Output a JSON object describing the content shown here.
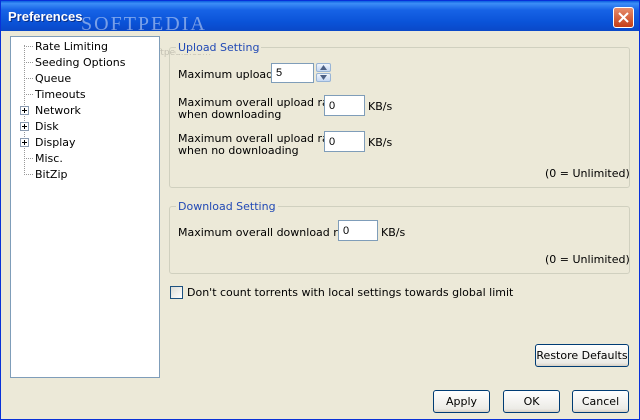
{
  "window": {
    "title": "Preferences"
  },
  "watermark": {
    "text": "SOFTPEDIA",
    "url": "www.softpedia.com"
  },
  "tree": {
    "items": [
      {
        "label": "Rate Limiting",
        "expandable": false
      },
      {
        "label": "Seeding Options",
        "expandable": false
      },
      {
        "label": "Queue",
        "expandable": false
      },
      {
        "label": "Timeouts",
        "expandable": false
      },
      {
        "label": "Network",
        "expandable": true
      },
      {
        "label": "Disk",
        "expandable": true
      },
      {
        "label": "Display",
        "expandable": true
      },
      {
        "label": "Misc.",
        "expandable": false
      },
      {
        "label": "BitZip",
        "expandable": false
      }
    ]
  },
  "upload": {
    "legend": "Upload Setting",
    "max_uploads_label": "Maximum uploads:",
    "max_uploads_value": "5",
    "rate_downloading_label_1": "Maximum overall upload rate:",
    "rate_downloading_label_2": "when downloading",
    "rate_downloading_value": "0",
    "rate_no_downloading_label_1": "Maximum overall upload rate:",
    "rate_no_downloading_label_2": "when no downloading",
    "rate_no_downloading_value": "0",
    "unit": "KB/s",
    "note": "(0 = Unlimited)"
  },
  "download": {
    "legend": "Download Setting",
    "rate_label": "Maximum overall download rate:",
    "rate_value": "0",
    "unit": "KB/s",
    "note": "(0 = Unlimited)"
  },
  "options": {
    "global_limit_label": "Don't count torrents with local settings towards global limit",
    "global_limit_checked": false
  },
  "buttons": {
    "restore_defaults": "Restore Defaults",
    "apply": "Apply",
    "ok": "OK",
    "cancel": "Cancel"
  },
  "colors": {
    "titlebar": "#0a53d8",
    "dialog_bg": "#ece9d8",
    "legend": "#2149b5"
  },
  "icons": {
    "close": "close-icon",
    "spin_up": "spin-up-icon",
    "spin_down": "spin-down-icon",
    "expander": "plus-expander-icon"
  }
}
